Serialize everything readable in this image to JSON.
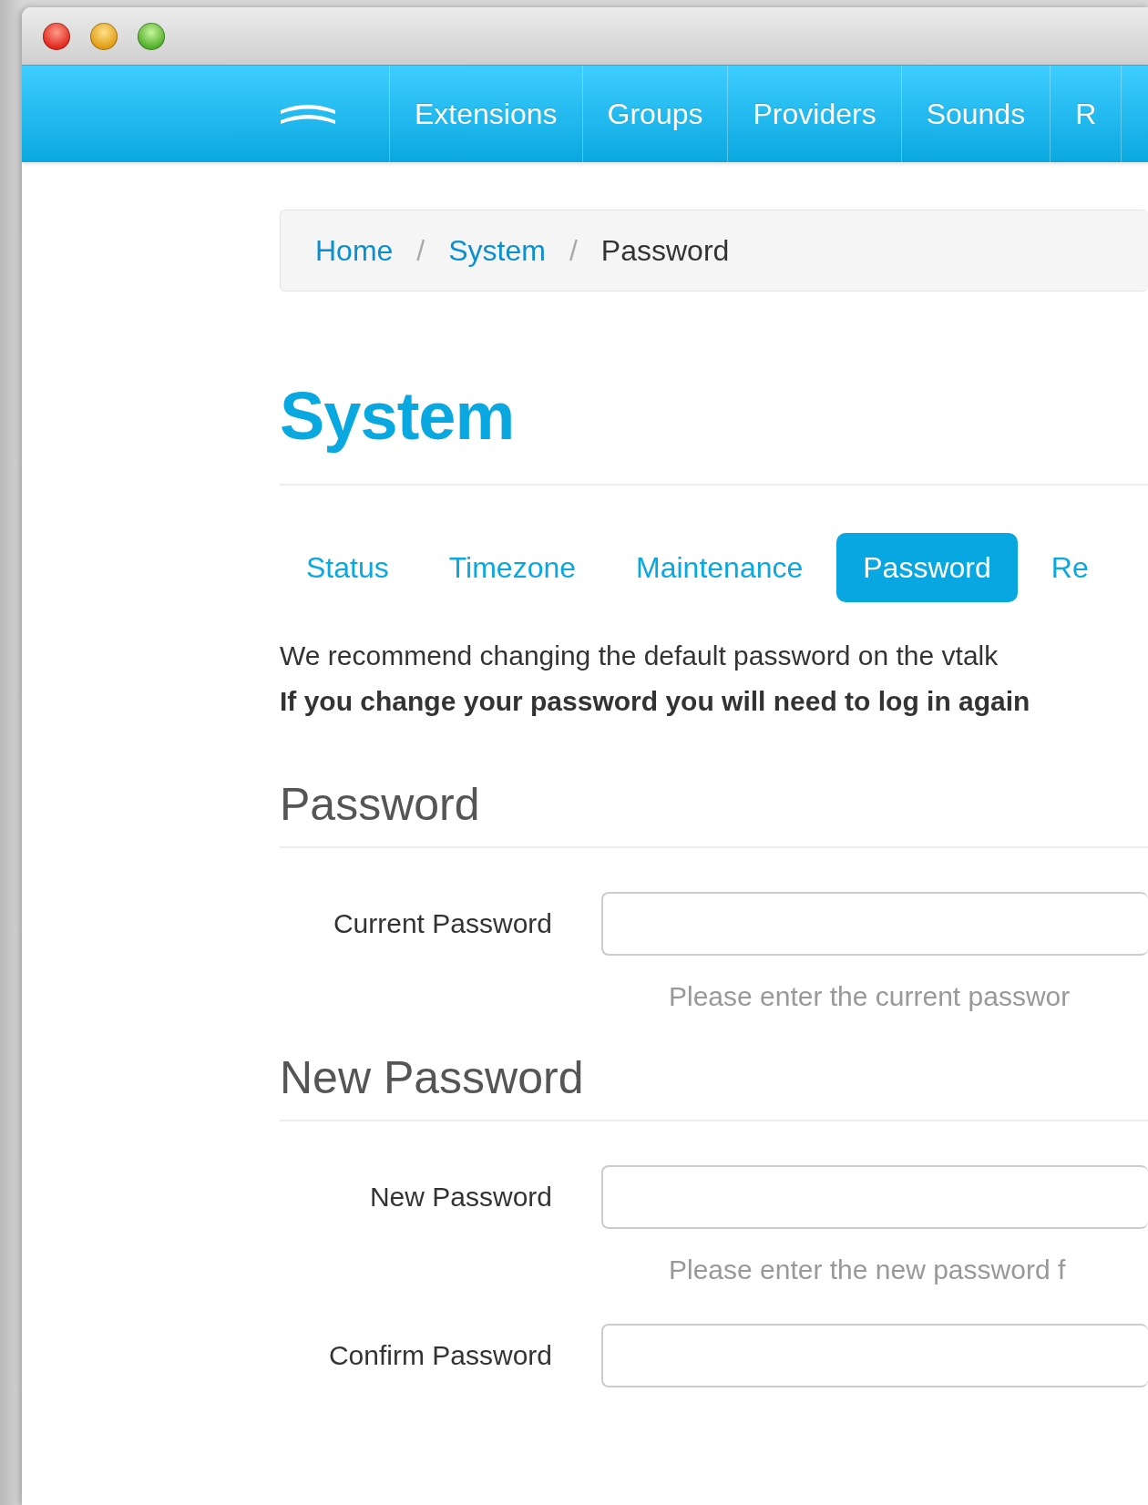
{
  "nav": {
    "items": [
      {
        "label": "Extensions"
      },
      {
        "label": "Groups"
      },
      {
        "label": "Providers"
      },
      {
        "label": "Sounds"
      },
      {
        "label": "R"
      }
    ]
  },
  "breadcrumb": [
    {
      "label": "Home",
      "kind": "link"
    },
    {
      "label": "/",
      "kind": "separator"
    },
    {
      "label": "System",
      "kind": "link"
    },
    {
      "label": "/",
      "kind": "separator"
    },
    {
      "label": "Password",
      "kind": "current"
    }
  ],
  "title": "System",
  "tabs": [
    {
      "label": "Status",
      "selected": false
    },
    {
      "label": "Timezone",
      "selected": false
    },
    {
      "label": "Maintenance",
      "selected": false
    },
    {
      "label": "Password",
      "selected": true
    },
    {
      "label": "Re",
      "selected": false
    }
  ],
  "intro": [
    {
      "text": "We recommend changing the default password on the vtalk",
      "kind": "plain"
    },
    {
      "text": "If you change your password you will need to log in again",
      "kind": "bold"
    }
  ],
  "sections": [
    {
      "heading": "Password",
      "fields": [
        {
          "label": "Current Password",
          "help": "Please enter the current passwor"
        }
      ]
    },
    {
      "heading": "New Password",
      "fields": [
        {
          "label": "New Password",
          "help": "Please enter the new password f"
        },
        {
          "label": "Confirm Password"
        }
      ]
    }
  ]
}
